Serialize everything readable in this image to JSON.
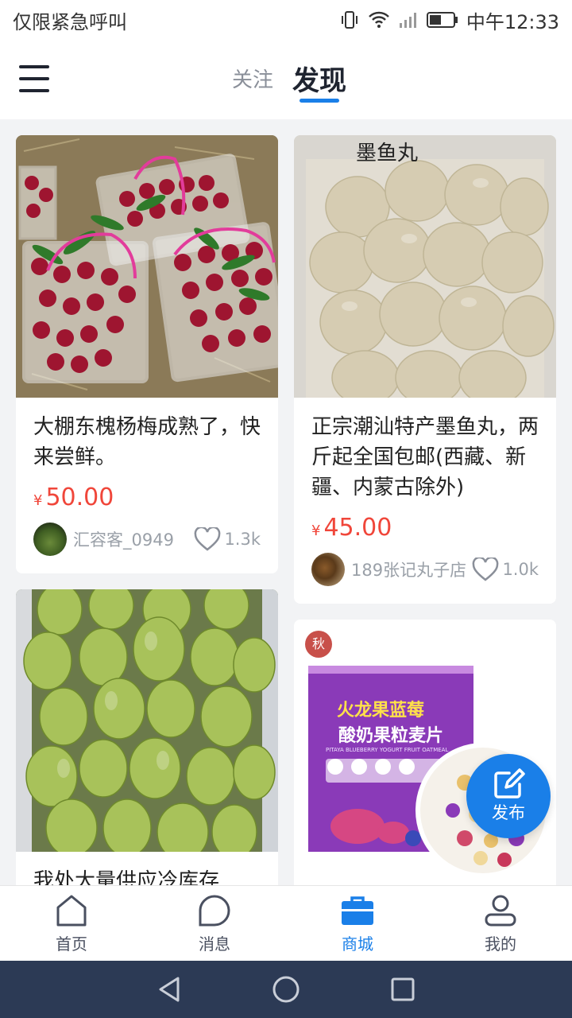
{
  "status_bar": {
    "carrier": "仅限紧急呼叫",
    "time": "中午12:33"
  },
  "header": {
    "tabs": [
      {
        "label": "关注",
        "active": false
      },
      {
        "label": "发现",
        "active": true
      }
    ]
  },
  "feed": {
    "left": [
      {
        "title": "大棚东槐杨梅成熟了，快来尝鲜。",
        "price_symbol": "¥",
        "price": "50.00",
        "seller": "汇容客_0949",
        "likes": "1.3k",
        "image": "bayberry-baskets"
      },
      {
        "title": "我处大量供应冷库存",
        "image": "green-pears"
      }
    ],
    "right": [
      {
        "title": "正宗潮汕特产墨鱼丸，两斤起全国包邮(西藏、新疆、内蒙古除外)",
        "price_symbol": "¥",
        "price": "45.00",
        "seller": "189张记丸子店",
        "likes": "1.0k",
        "image": "cuttlefish-balls",
        "image_label": "墨鱼丸"
      },
      {
        "title": "",
        "image": "oatmeal-package",
        "package_brand": "秋",
        "package_title_1": "火龙果蓝莓",
        "package_title_2": "酸奶果粒麦片",
        "package_subtitle": "PITAYA BLUEBERRY YOGURT FRUIT OATMEAL"
      }
    ]
  },
  "fab": {
    "label": "发布",
    "icon": "edit-icon"
  },
  "tabbar": {
    "items": [
      {
        "label": "首页",
        "icon": "home-icon",
        "active": false
      },
      {
        "label": "消息",
        "icon": "message-icon",
        "active": false
      },
      {
        "label": "商城",
        "icon": "shop-bag-icon",
        "active": true
      },
      {
        "label": "我的",
        "icon": "user-icon",
        "active": false
      }
    ]
  },
  "colors": {
    "accent": "#1a7fe8",
    "price": "#f0463a",
    "navbar": "#2c3a55"
  }
}
